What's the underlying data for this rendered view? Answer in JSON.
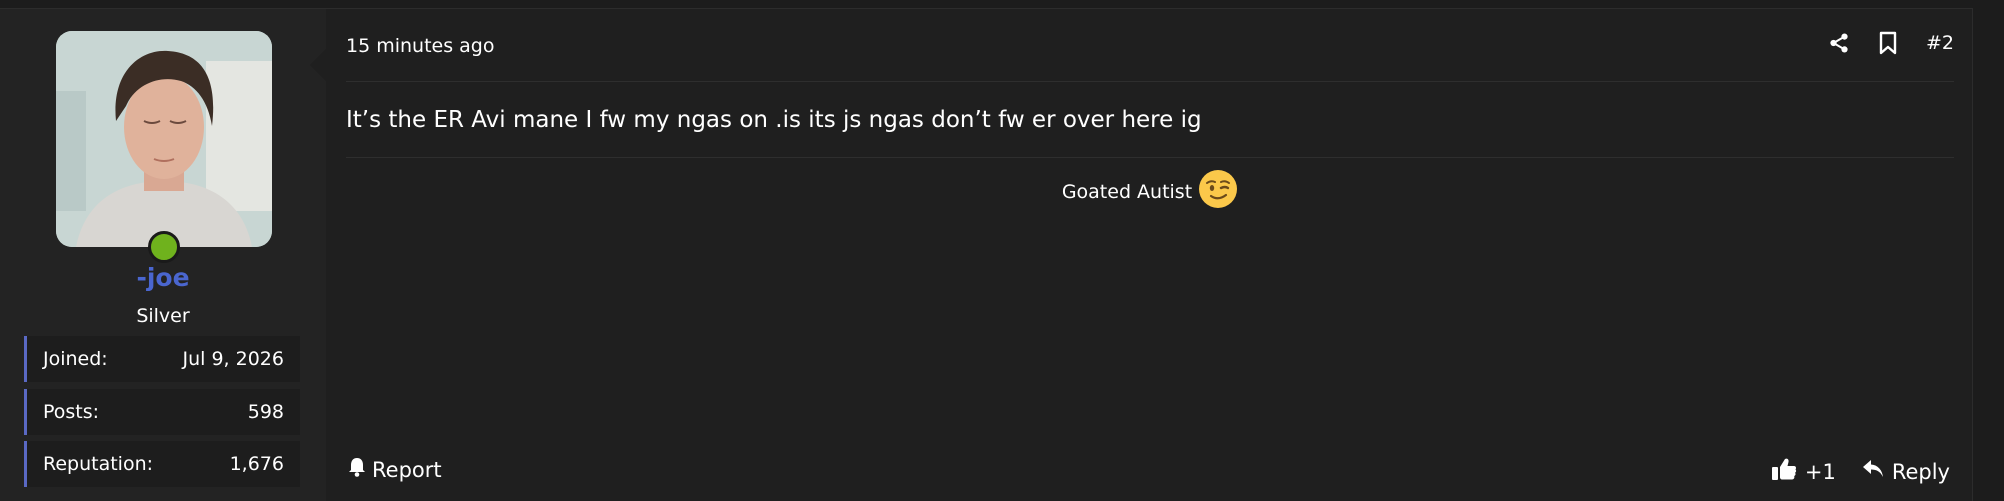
{
  "post": {
    "time": "15 minutes ago",
    "post_number": "#2",
    "message": "It’s the ER Avi mane I fw my ngas on .is its js ngas don’t fw er over here ig",
    "signature": "Goated Autist",
    "report_label": "Report",
    "reaction_count": "+1",
    "reply_label": "Reply"
  },
  "user": {
    "username": "-joe",
    "rank": "Silver",
    "online": true,
    "stats": [
      {
        "label": "Joined:",
        "value": "Jul 9, 2026"
      },
      {
        "label": "Posts:",
        "value": "598"
      },
      {
        "label": "Reputation:",
        "value": "1,676"
      }
    ]
  },
  "icons": {
    "share": "share-icon",
    "bookmark": "bookmark-icon",
    "report": "bell-icon",
    "like": "thumbs-up-icon",
    "reply": "reply-icon",
    "signature_emoji": "wink-emoji-icon"
  },
  "colors": {
    "username": "#4a66cf",
    "online": "#6fb21d",
    "stat_accent": "#5a69c4"
  }
}
